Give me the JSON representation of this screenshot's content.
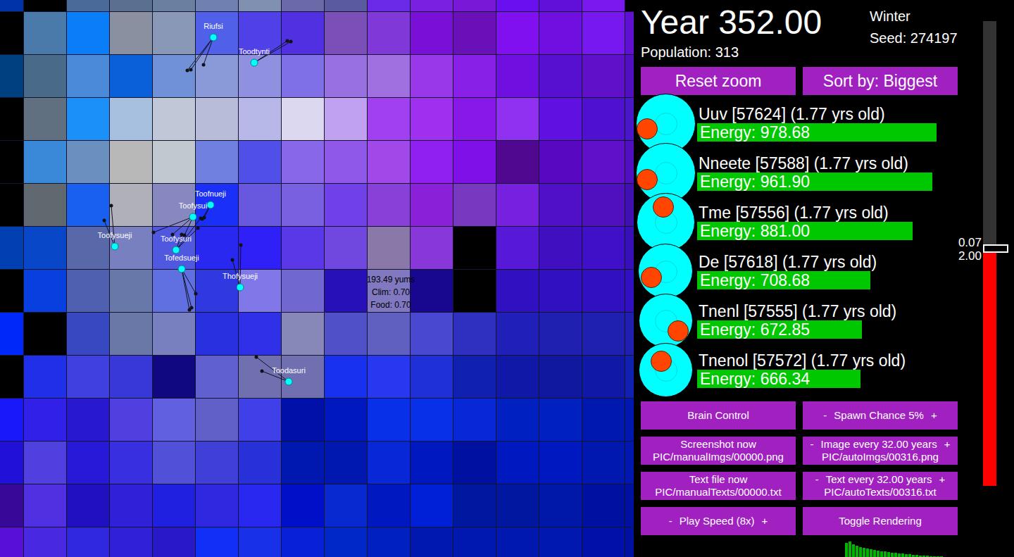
{
  "map": {
    "tiles": [
      [
        "#0033aa",
        "#000000",
        "#4a6a9a",
        "#5a7090",
        "#6a80a0",
        "#7080b0",
        "#8090b0",
        "#6a6aa8",
        "#5a5aa0",
        "#6a2ae8",
        "#7a20e0",
        "#7a18d8",
        "#6a10f0",
        "#6010d8",
        "#7a18f0",
        "#000000"
      ],
      [
        "#000000",
        "#4a7aaa",
        "#0a7ef8",
        "#8a90a0",
        "#8a98b8",
        "#5060e8",
        "#5040e8",
        "#5030e0",
        "#7a50b8",
        "#8038d8",
        "#7a10d8",
        "#6a10b8",
        "#8010f0",
        "#7010e0",
        "#7818f0",
        "#6010d0"
      ],
      [
        "#004080",
        "#4a6a8a",
        "#4a8ad8",
        "#0a60d8",
        "#7090d8",
        "#8a9ad8",
        "#9090e0",
        "#8070e8",
        "#9870e0",
        "#a070e0",
        "#9838e8",
        "#8820e8",
        "#7010e0",
        "#5810d0",
        "#6010c8",
        "#5010c0"
      ],
      [
        "#000000",
        "#607080",
        "#1a90f8",
        "#a8c0e0",
        "#c0c8d8",
        "#b8bcd8",
        "#b8b8e8",
        "#dcd8f0",
        "#c0a0f0",
        "#a040f0",
        "#a030f0",
        "#8818e8",
        "#9030f0",
        "#6010e0",
        "#5010d0",
        "#4818c8"
      ],
      [
        "#000000",
        "#3a88d8",
        "#6a90c0",
        "#b8b8b8",
        "#c0c8d0",
        "#7080e0",
        "#5050e8",
        "#8868e8",
        "#9058e8",
        "#a048e8",
        "#9020f0",
        "#8010e8",
        "#500890",
        "#5808c0",
        "#6010c8",
        "#5010c0"
      ],
      [
        "#000000",
        "#606870",
        "#1a60f0",
        "#b0b0b8",
        "#8888c0",
        "#1a30f8",
        "#6858e0",
        "#7860e0",
        "#7040e8",
        "#8840d8",
        "#8a20d8",
        "#7838c0",
        "#7820e0",
        "#5010c8",
        "#5010c0",
        "#4010b0"
      ],
      [
        "#0040b0",
        "#0848c8",
        "#5868a8",
        "#7880c0",
        "#5058e0",
        "#2828f0",
        "#3020f8",
        "#5a38e8",
        "#7048e0",
        "#8a78a8",
        "#8838d8",
        "#000000",
        "#5818d8",
        "#4010c0",
        "#4010c8",
        "#3810b8"
      ],
      [
        "#000000",
        "#0840e0",
        "#5060b0",
        "#6878a8",
        "#6070e0",
        "#3038e0",
        "#8078e8",
        "#7068d0",
        "#2810b8",
        "#8078c0",
        "#180890",
        "#000000",
        "#3010c0",
        "#3010c0",
        "#3010c0",
        "#3010c0"
      ],
      [
        "#0028f8",
        "#000000",
        "#3848c0",
        "#6a78a8",
        "#7880c0",
        "#2830e0",
        "#3030e8",
        "#8888b8",
        "#5050c8",
        "#6060c0",
        "#4848d0",
        "#3030c0",
        "#2020b8",
        "#2020b0",
        "#2020b0",
        "#2020b0"
      ],
      [
        "#000000",
        "#2030e8",
        "#4040e0",
        "#3838d8",
        "#100880",
        "#6060d0",
        "#7070b0",
        "#7070b0",
        "#1830f0",
        "#2838f0",
        "#2030d8",
        "#1020b0",
        "#1018a8",
        "#1018a0",
        "#1018a8",
        "#1020b0"
      ],
      [
        "#1818f8",
        "#3020e8",
        "#2818d0",
        "#5040e0",
        "#6060e0",
        "#6060c8",
        "#4040e8",
        "#0010a8",
        "#0018c0",
        "#0830e8",
        "#0830e8",
        "#0828d8",
        "#0020c0",
        "#0020c0",
        "#0018b0",
        "#0018b0"
      ],
      [
        "#2010d8",
        "#5040e0",
        "#2818d8",
        "#3830e0",
        "#5050d8",
        "#4040d8",
        "#2830d8",
        "#0018b0",
        "#0018b0",
        "#0828d8",
        "#0018c0",
        "#0010a0",
        "#0018c0",
        "#0018c0",
        "#0018b0",
        "#0018b0"
      ],
      [
        "#380898",
        "#5030e0",
        "#2010c0",
        "#3020d8",
        "#2020e0",
        "#3028e0",
        "#2828f0",
        "#0010c8",
        "#0828d0",
        "#0018c0",
        "#0020d8",
        "#0018a0",
        "#0018a0",
        "#0018a8",
        "#0010a0",
        "#0010a0"
      ],
      [
        "#5810d8",
        "#4828e0",
        "#3028e0",
        "#3020d8",
        "#2818c8",
        "#1030f8",
        "#1830e8",
        "#0820d8",
        "#0028c8",
        "#0020c0",
        "#0018b0",
        "#0018b0",
        "#0018b0",
        "#0018b0",
        "#0010a8",
        "#0010a0"
      ]
    ],
    "tooltip": [
      "193.49 yums",
      "Clim: 0.70",
      "Food: 0.70"
    ]
  },
  "map_creatures": [
    {
      "name": "Riufsi"
    },
    {
      "name": "Toodtynti"
    },
    {
      "name": "Toofnueji"
    },
    {
      "name": "Toofysui"
    },
    {
      "name": "Toofysueji"
    },
    {
      "name": "Toofysuri"
    },
    {
      "name": "Tofedsueji"
    },
    {
      "name": "Thofysueji"
    },
    {
      "name": "Toodasuri"
    }
  ],
  "header": {
    "year": "Year 352.00",
    "population": "Population: 313",
    "season": "Winter",
    "seed": "Seed: 274197"
  },
  "top_buttons": [
    "Reset zoom",
    "Sort by: Biggest"
  ],
  "leaderboard": [
    {
      "name": "Uuv [57624] (1.77 yrs old)",
      "energy": "Energy: 978.68",
      "level": 0.97
    },
    {
      "name": "Nneete [57588] (1.77 yrs old)",
      "energy": "Energy: 961.90",
      "level": 0.954
    },
    {
      "name": "Tme [57556] (1.77 yrs old)",
      "energy": "Energy: 881.00",
      "level": 0.874
    },
    {
      "name": "De [57618] (1.77 yrs old)",
      "energy": "Energy: 708.68",
      "level": 0.703
    },
    {
      "name": "Tnenl [57555] (1.77 yrs old)",
      "energy": "Energy: 672.85",
      "level": 0.669
    },
    {
      "name": "Tnenol [57572] (1.77 yrs old)",
      "energy": "Energy: 666.34",
      "level": 0.663
    }
  ],
  "control_buttons": [
    {
      "kind": "single",
      "lines": [
        "Brain Control"
      ]
    },
    {
      "kind": "stepper",
      "minus": "-",
      "plus": "+",
      "lines": [
        "Spawn Chance 5%"
      ]
    },
    {
      "kind": "single",
      "lines": [
        "Screenshot now",
        "PIC/manualImgs/00000.png"
      ]
    },
    {
      "kind": "stepper",
      "minus": "-",
      "plus": "+",
      "lines": [
        "Image every 32.00 years",
        "PIC/autoImgs/00316.png"
      ]
    },
    {
      "kind": "single",
      "lines": [
        "Text file now",
        "PIC/manualTexts/00000.txt"
      ]
    },
    {
      "kind": "stepper",
      "minus": "-",
      "plus": "+",
      "lines": [
        "Text every 32.00 years",
        "PIC/autoTexts/00316.txt"
      ]
    },
    {
      "kind": "stepper",
      "minus": "-",
      "plus": "+",
      "lines": [
        "Play Speed (8x)"
      ]
    },
    {
      "kind": "single",
      "lines": [
        "Toggle Rendering"
      ]
    }
  ],
  "time_gauge": {
    "level": 0.51,
    "labels": [
      "0.07",
      "2.00"
    ]
  },
  "histogram": {
    "values": [
      20,
      22,
      18,
      16,
      14,
      13,
      12,
      11,
      10,
      9,
      8,
      8,
      7,
      6,
      6,
      5,
      5,
      4,
      4,
      3,
      3,
      2,
      2,
      2,
      1,
      1,
      1,
      1
    ]
  }
}
